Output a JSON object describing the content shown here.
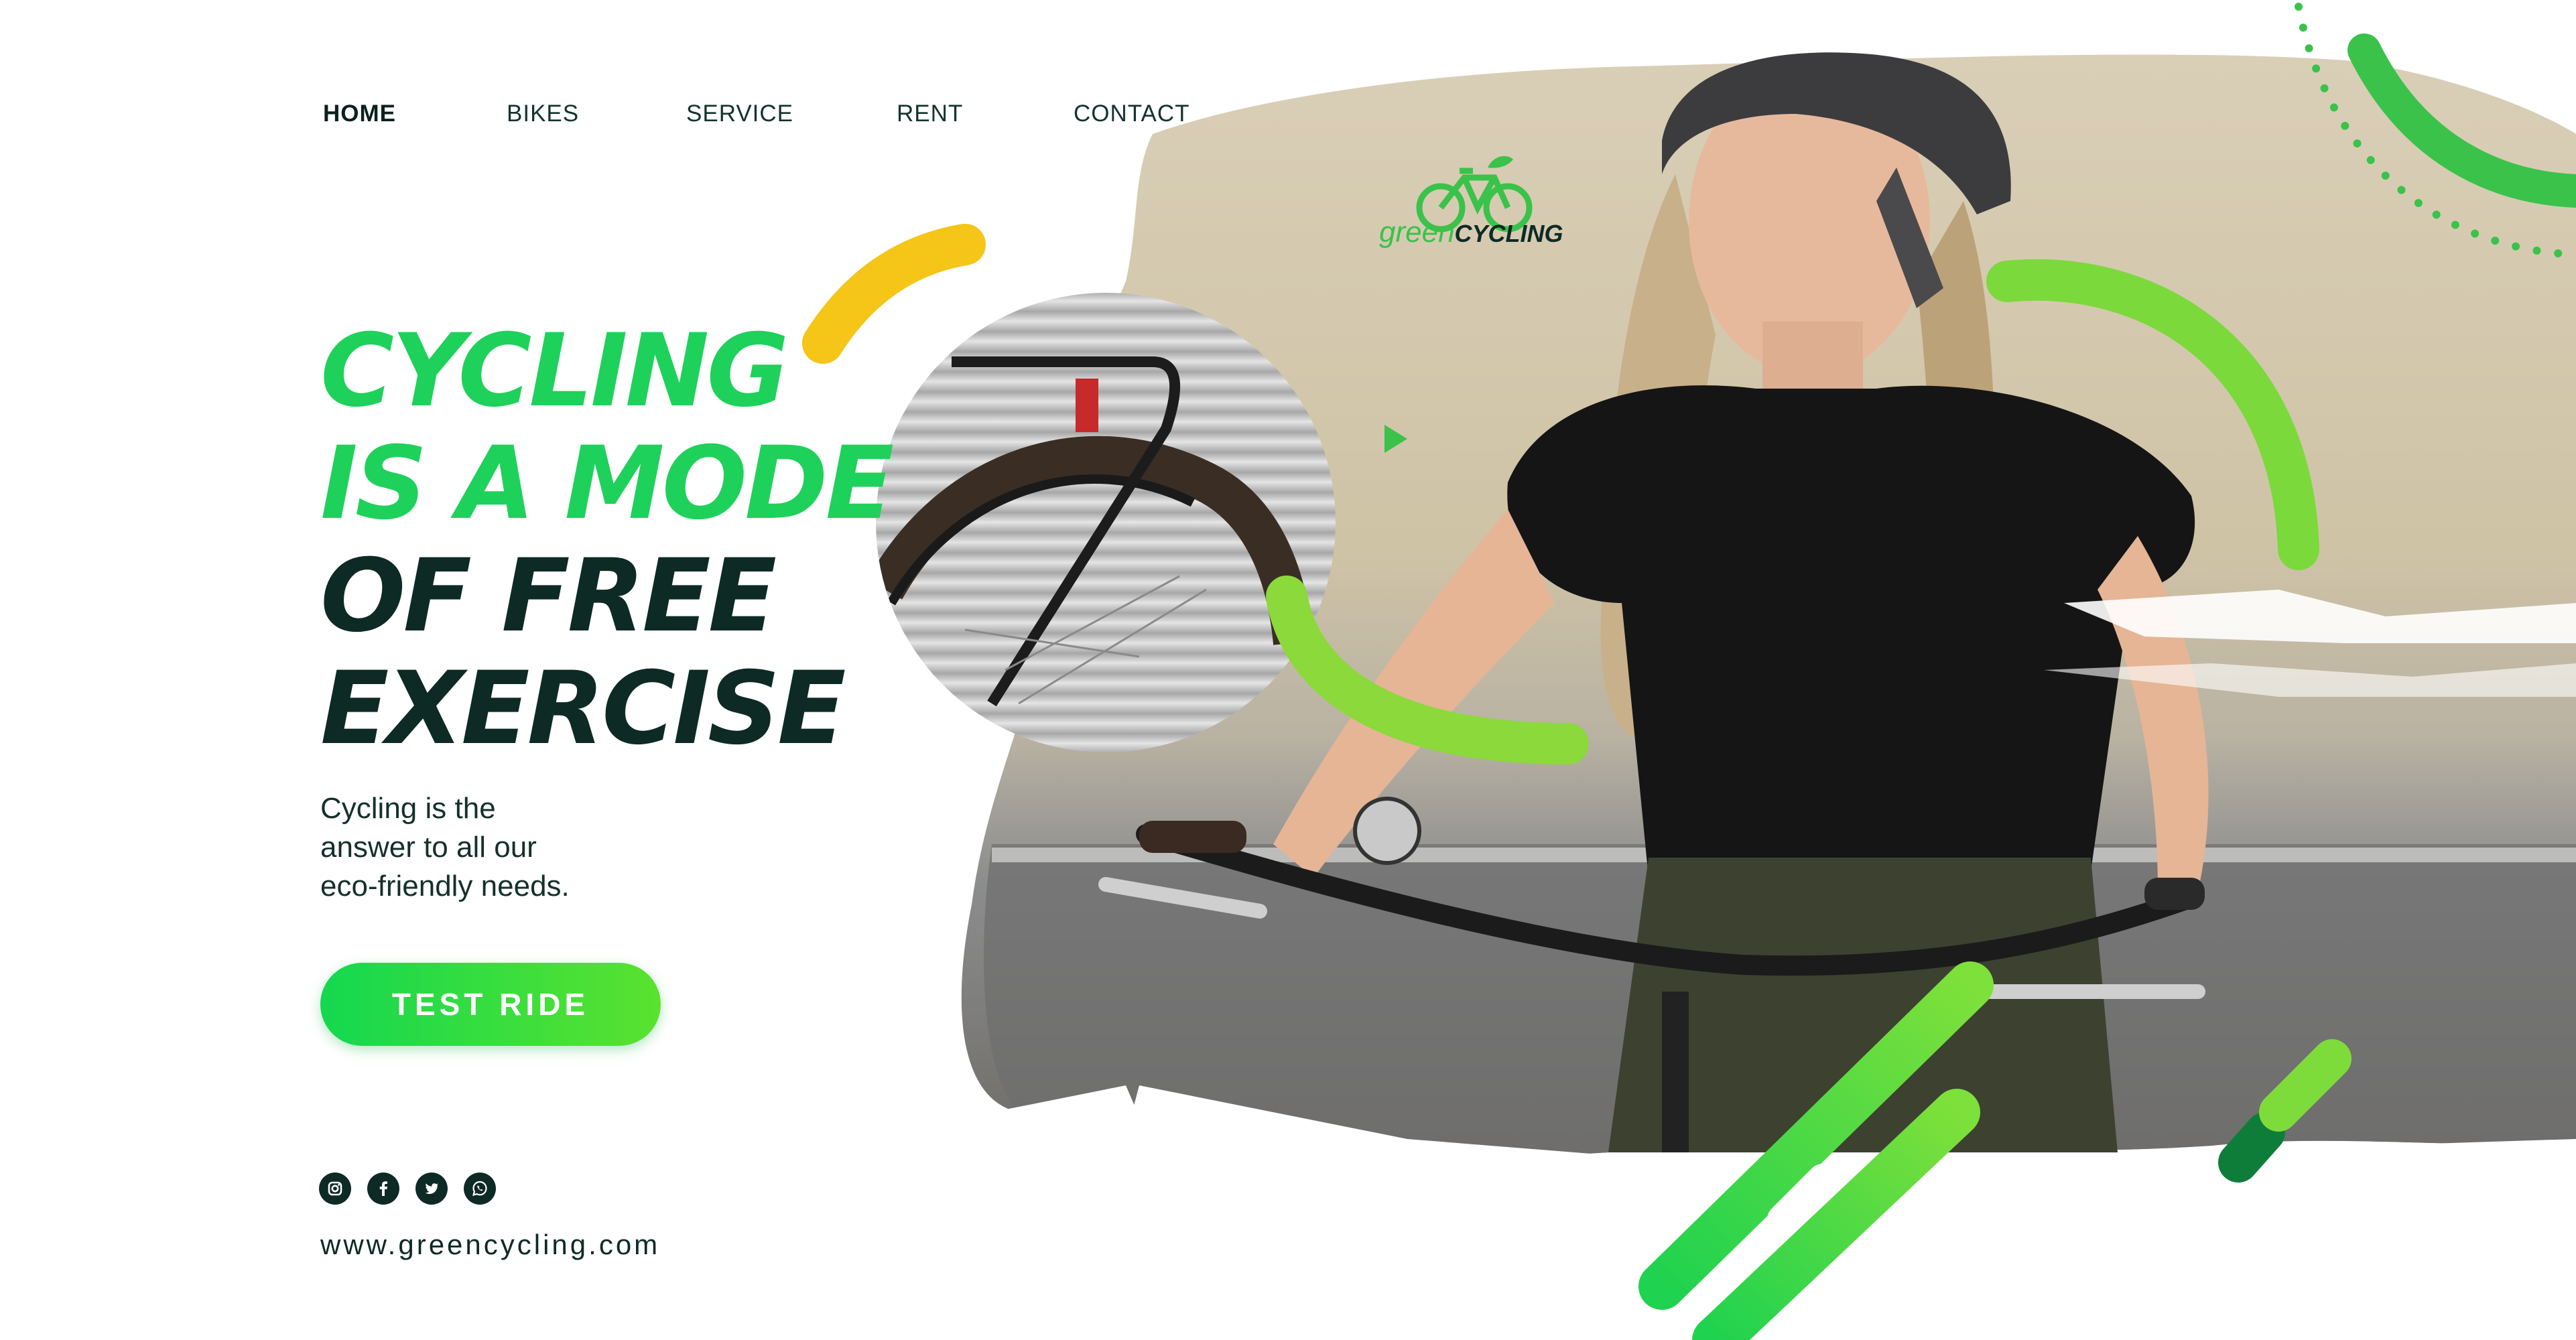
{
  "nav": {
    "items": [
      {
        "label": "HOME",
        "active": true
      },
      {
        "label": "BIKES",
        "active": false
      },
      {
        "label": "SERVICE",
        "active": false
      },
      {
        "label": "RENT",
        "active": false
      },
      {
        "label": "CONTACT",
        "active": false
      }
    ]
  },
  "hero": {
    "line1": "CYCLING",
    "line2": "IS A MODE",
    "line3": "OF FREE",
    "line4": "EXERCISE",
    "sub1": "Cycling is the",
    "sub2": "answer to all our",
    "sub3": "eco-friendly needs.",
    "cta_label": "TEST RIDE"
  },
  "logo": {
    "part1": "green",
    "part2": "CYCLING",
    "icon": "bicycle-icon"
  },
  "socials": [
    "instagram-icon",
    "facebook-icon",
    "twitter-icon",
    "whatsapp-icon"
  ],
  "footer": {
    "url": "www.greencycling.com"
  },
  "colors": {
    "brand_green": "#1ed15a",
    "lime": "#7fd93a",
    "dark": "#0e2a25",
    "yellow": "#f5c518",
    "play": "#3ac24a"
  }
}
